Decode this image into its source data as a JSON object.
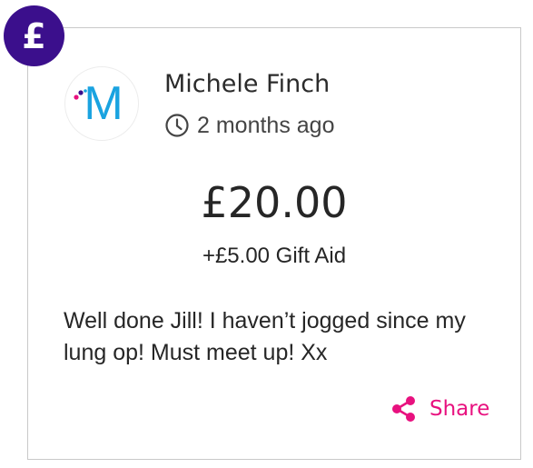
{
  "badge": {
    "glyph": "£",
    "icon": "pound-sign-icon",
    "color": "#3b0f8c"
  },
  "donor": {
    "avatar_letter": "M",
    "avatar_icon": "profile-initial-icon",
    "avatar_color": "#1aa3e0",
    "name": "Michele Finch",
    "time_icon": "clock-icon",
    "time_ago": "2 months ago"
  },
  "donation": {
    "amount": "£20.00",
    "gift_aid": "+£5.00 Gift Aid",
    "message": "Well done Jill! I haven’t jogged since my lung op! Must meet up! Xx"
  },
  "share": {
    "label": "Share",
    "icon": "share-icon",
    "color": "#e8117f"
  }
}
